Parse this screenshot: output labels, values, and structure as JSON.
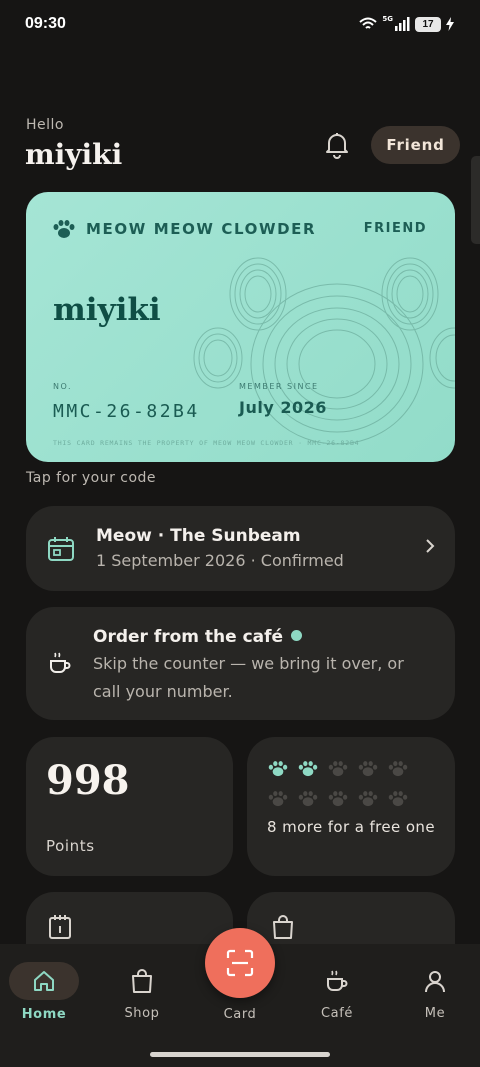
{
  "status_bar": {
    "time": "09:30",
    "network": "5G",
    "battery": "17"
  },
  "header": {
    "greeting": "Hello",
    "username": "miyiki",
    "tier_badge": "Friend"
  },
  "member_card": {
    "brand": "MEOW MEOW CLOWDER",
    "tier": "FRIEND",
    "name": "miyiki",
    "number_label": "NO.",
    "number": "MMC-26-82B4",
    "member_since_label": "MEMBER SINCE",
    "member_since": "July 2026",
    "footer": "THIS CARD REMAINS THE PROPERTY OF MEOW MEOW CLOWDER · MMC-26-82B4",
    "color": "#9fe2d1"
  },
  "tap_hint": "Tap for your code",
  "booking": {
    "title": "Meow · The Sunbeam",
    "subtitle": "1 September 2026 · Confirmed"
  },
  "order": {
    "title": "Order from the café",
    "description": "Skip the counter — we bring it over, or call your number."
  },
  "points": {
    "value": "998",
    "label": "Points"
  },
  "stamps": {
    "collected": 2,
    "total": 10,
    "text": "8 more for a free one"
  },
  "bottom_nav": {
    "items": [
      {
        "label": "Home",
        "icon": "home-icon",
        "active": true
      },
      {
        "label": "Shop",
        "icon": "shopping-bag-icon"
      },
      {
        "label": "Card",
        "icon": "scan-icon"
      },
      {
        "label": "Café",
        "icon": "coffee-cup-icon"
      },
      {
        "label": "Me",
        "icon": "person-icon"
      }
    ]
  },
  "colors": {
    "accent": "#8ed8c3",
    "fab": "#ef6f5c",
    "background": "#161514",
    "tile": "#272624"
  }
}
